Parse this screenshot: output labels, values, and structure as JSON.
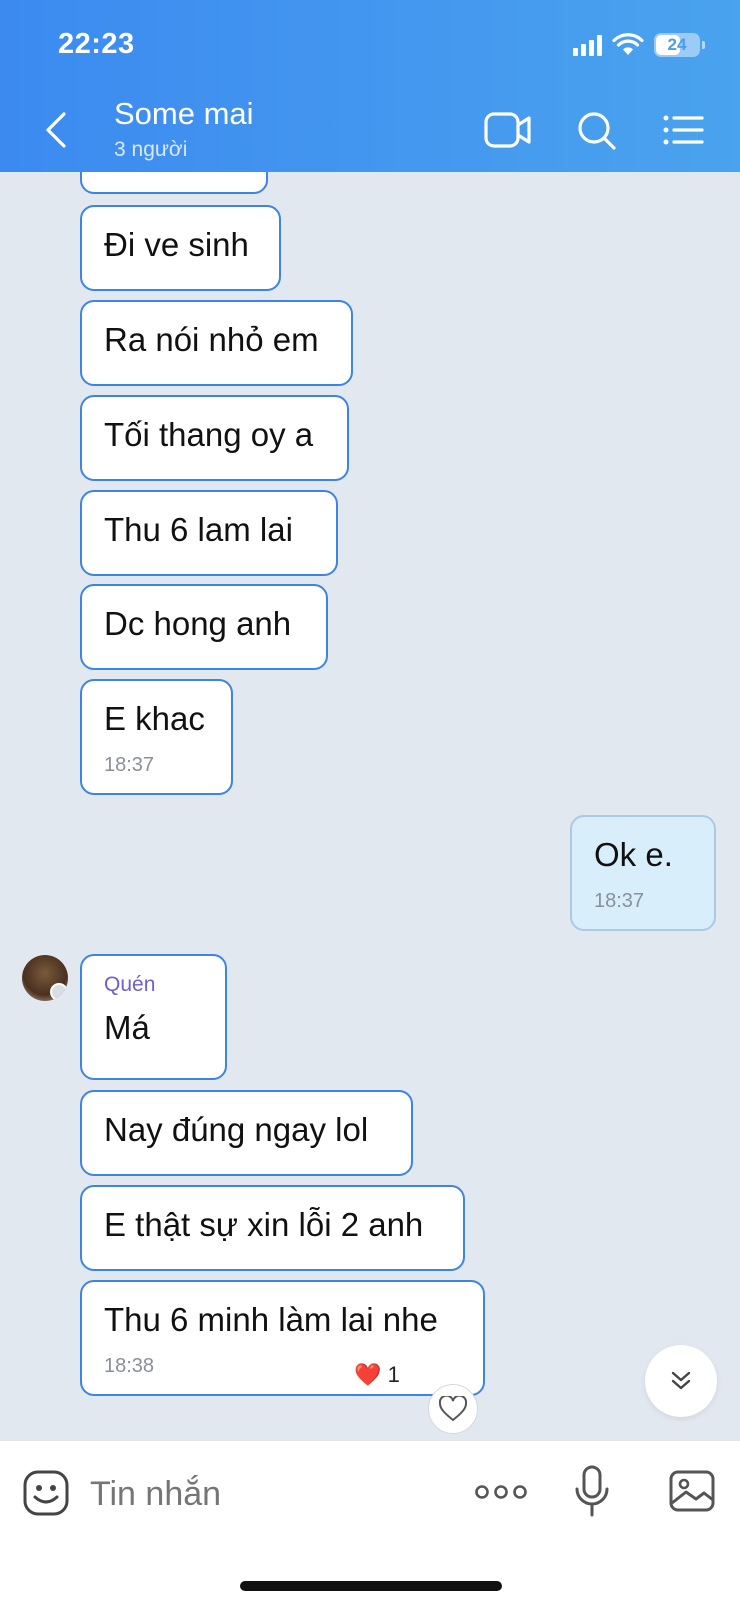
{
  "status_bar": {
    "time": "22:23",
    "battery": "24"
  },
  "header": {
    "title": "Some mai",
    "subtitle": "3 người"
  },
  "messages": [
    {
      "text": ""
    },
    {
      "text": "Đi ve sinh"
    },
    {
      "text": "Ra nói nhỏ em"
    },
    {
      "text": "Tối thang oy a"
    },
    {
      "text": "Thu  6 lam lai"
    },
    {
      "text": "Dc hong anh"
    },
    {
      "text": "E khac",
      "time": "18:37"
    },
    {
      "text": "Ok e.",
      "time": "18:37",
      "mine": true
    },
    {
      "sender": "Quén",
      "text": "Má"
    },
    {
      "text": "Nay đúng ngay lol"
    },
    {
      "text": "E thật sự xin lỗi 2 anh"
    },
    {
      "text": "Thu 6 minh làm lai nhe",
      "time": "18:38"
    }
  ],
  "reaction": {
    "emoji": "❤️",
    "count": "1"
  },
  "composer": {
    "placeholder": "Tin nhắn"
  },
  "colors": {
    "header_start": "#3c8af0",
    "header_end": "#4aa3ee",
    "bubble_border": "#3d84e6",
    "sender_name": "#6d5fd3",
    "my_bubble": "#d9eefb"
  },
  "icons": [
    "back-icon",
    "video-call-icon",
    "search-icon",
    "menu-list-icon",
    "emoji-icon",
    "more-icon",
    "microphone-icon",
    "image-icon",
    "heart-icon",
    "chevron-double-down-icon"
  ]
}
